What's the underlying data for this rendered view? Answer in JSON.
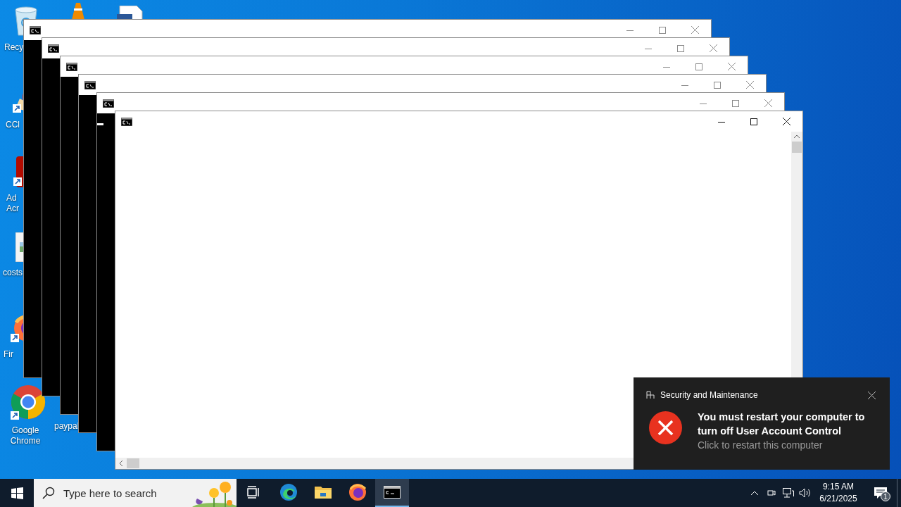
{
  "desktop_icons": [
    {
      "kind": "recycle-bin",
      "lines": [
        "Recy"
      ]
    },
    {
      "kind": "ccleaner",
      "lines": [
        "CCl"
      ]
    },
    {
      "kind": "acrobat",
      "lines": [
        "Ad",
        "Acr"
      ]
    },
    {
      "kind": "image-file",
      "lines": [
        "costs"
      ]
    },
    {
      "kind": "firefox",
      "lines": [
        "Fir"
      ]
    },
    {
      "kind": "chrome",
      "lines": [
        "Google",
        "Chrome"
      ]
    },
    {
      "kind": "none",
      "lines": [
        "paypal"
      ]
    },
    {
      "kind": "vlc"
    },
    {
      "kind": "document"
    }
  ],
  "windows": [
    {
      "kind": "console",
      "active": false,
      "cursor": false
    },
    {
      "kind": "console",
      "active": false,
      "cursor": false
    },
    {
      "kind": "console",
      "active": false,
      "cursor": false
    },
    {
      "kind": "console",
      "active": false,
      "cursor": false
    },
    {
      "kind": "console",
      "active": false,
      "cursor": true
    },
    {
      "kind": "blank",
      "active": true,
      "cursor": false
    }
  ],
  "notification": {
    "source": "Security and Maintenance",
    "title": "You must restart your computer to turn off User Account Control",
    "body": "Click to restart this computer"
  },
  "taskbar": {
    "search": {
      "placeholder": "Type here to search"
    },
    "apps": [
      {
        "kind": "task-view",
        "selected": false
      },
      {
        "kind": "edge",
        "selected": false
      },
      {
        "kind": "explorer",
        "selected": false
      },
      {
        "kind": "firefox",
        "selected": false
      },
      {
        "kind": "console",
        "selected": true
      }
    ],
    "time": "9:15 AM",
    "date": "6/21/2025",
    "notification_count": "1"
  }
}
